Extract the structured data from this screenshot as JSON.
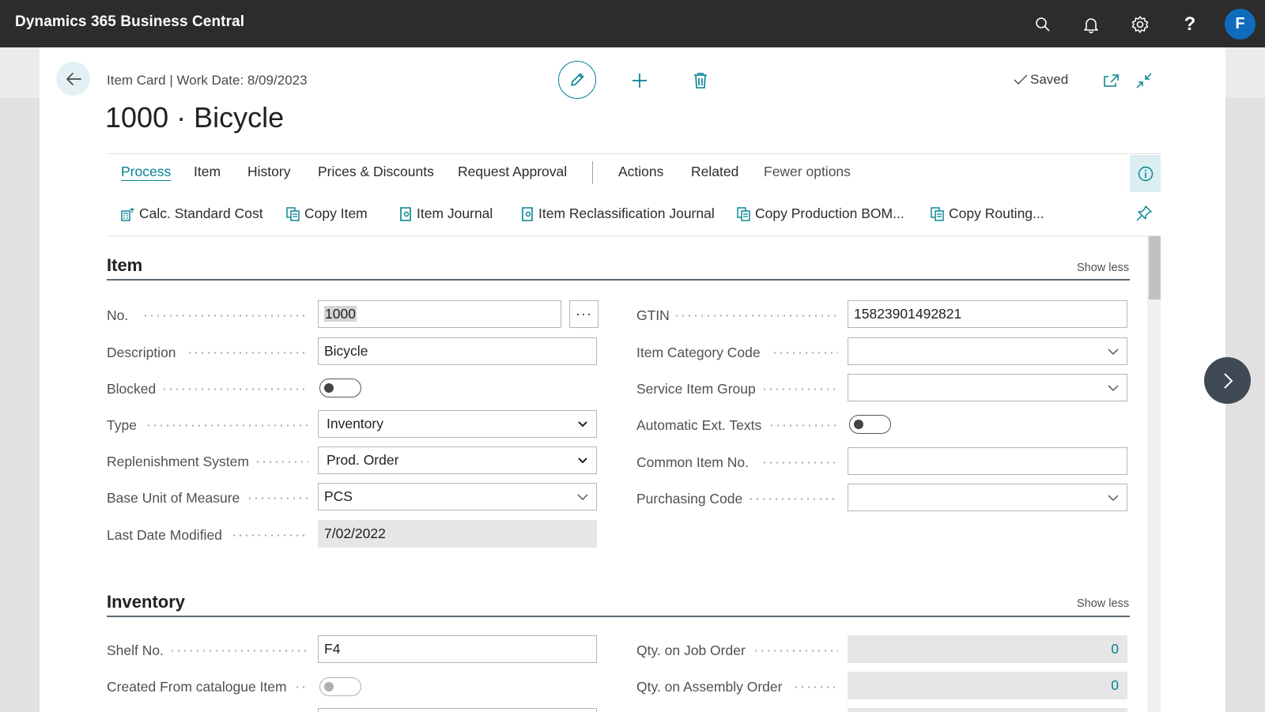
{
  "app": {
    "title": "Dynamics 365 Business Central",
    "avatar_initial": "F"
  },
  "topbar_icons": [
    "search-icon",
    "bell-icon",
    "gear-icon",
    "help-icon"
  ],
  "header": {
    "breadcrumb": "Item Card | Work Date: 8/09/2023",
    "title": "1000 · Bicycle",
    "saved_label": "Saved"
  },
  "menu": {
    "tabs": [
      "Process",
      "Item",
      "History",
      "Prices & Discounts",
      "Request Approval",
      "Actions",
      "Related",
      "Fewer options"
    ],
    "active_tab": "Process"
  },
  "actions": [
    "Calc. Standard Cost",
    "Copy Item",
    "Item Journal",
    "Item Reclassification Journal",
    "Copy Production BOM...",
    "Copy Routing..."
  ],
  "item_section": {
    "title": "Item",
    "show_less": "Show less",
    "left": [
      {
        "label": "No.",
        "value": "1000"
      },
      {
        "label": "Description",
        "value": "Bicycle"
      },
      {
        "label": "Blocked",
        "value": "off"
      },
      {
        "label": "Type",
        "value": "Inventory"
      },
      {
        "label": "Replenishment System",
        "value": "Prod. Order"
      },
      {
        "label": "Base Unit of Measure",
        "value": "PCS"
      },
      {
        "label": "Last Date Modified",
        "value": "7/02/2022"
      }
    ],
    "right": [
      {
        "label": "GTIN",
        "value": "15823901492821"
      },
      {
        "label": "Item Category Code",
        "value": ""
      },
      {
        "label": "Service Item Group",
        "value": ""
      },
      {
        "label": "Automatic Ext. Texts",
        "value": "off"
      },
      {
        "label": "Common Item No.",
        "value": ""
      },
      {
        "label": "Purchasing Code",
        "value": ""
      }
    ]
  },
  "inventory_section": {
    "title": "Inventory",
    "show_less": "Show less",
    "left": [
      {
        "label": "Shelf No.",
        "value": "F4"
      },
      {
        "label": "Created From catalogue Item",
        "value": "off"
      }
    ],
    "right": [
      {
        "label": "Qty. on Job Order",
        "value": "0"
      },
      {
        "label": "Qty. on Assembly Order",
        "value": "0"
      }
    ]
  },
  "colors": {
    "accent": "#00818f",
    "topbar": "#2c2c2c",
    "avatar": "#0f6cbd"
  }
}
